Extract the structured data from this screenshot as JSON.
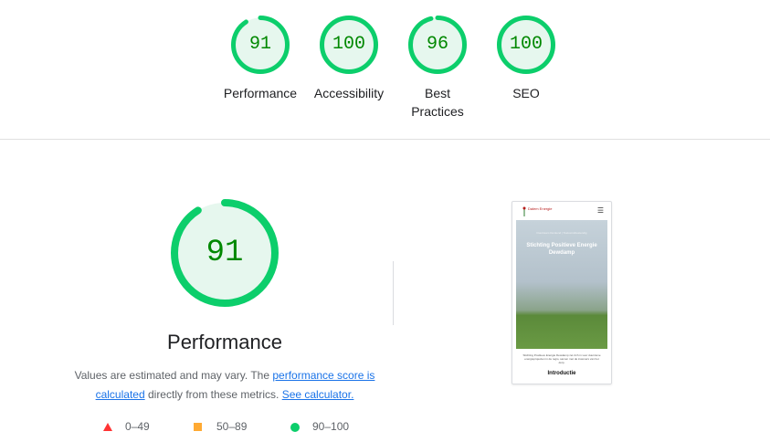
{
  "summary": {
    "scores": [
      {
        "label": "Performance",
        "value": "91",
        "fraction": 0.91
      },
      {
        "label": "Accessibility",
        "value": "100",
        "fraction": 1.0
      },
      {
        "label": "Best Practices",
        "value": "96",
        "fraction": 0.96
      },
      {
        "label": "SEO",
        "value": "100",
        "fraction": 1.0
      }
    ]
  },
  "performance": {
    "score": "91",
    "fraction": 0.91,
    "title": "Performance",
    "desc_before": "Values are estimated and may vary. The ",
    "link_score": "performance score is calculated",
    "desc_middle": " directly from these metrics. ",
    "link_calculator": "See calculator."
  },
  "legend": {
    "fail": "0–49",
    "average": "50–89",
    "pass": "90–100"
  },
  "screenshot": {
    "logo_text": "Dalem Energie",
    "hero_kicker": "Duurzaam Denkend | Toekomstbestendig",
    "hero_title": "Stichting Positieve Energie Dewdamp",
    "body_text": "Stichting Positieve Energie Dewdamp zet zich in voor duurzame energieprojecten in de regio, samen met de inwoners van het dorp.",
    "intro_heading": "Introductie"
  },
  "colors": {
    "pass": "#0cce6b",
    "pass_text": "#008800",
    "pass_fill": "#e6f7ee",
    "average": "#ffaa33",
    "fail": "#ff3333",
    "link": "#1a73e8"
  }
}
